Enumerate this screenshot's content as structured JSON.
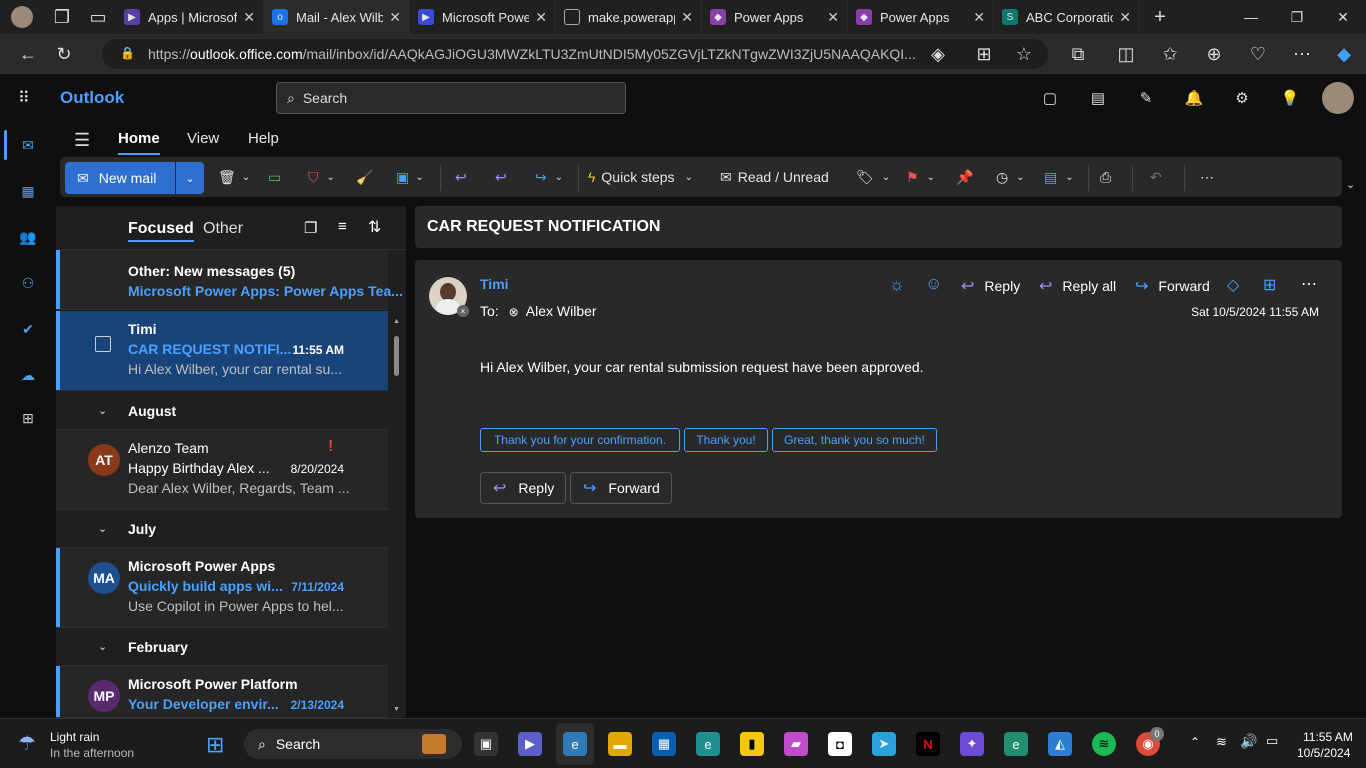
{
  "browser": {
    "tabs": [
      {
        "title": "Apps | Microsoft",
        "icon": "power-apps-icon",
        "color": "#7a4bd1"
      },
      {
        "title": "Mail - Alex Wilber",
        "icon": "outlook-icon",
        "color": "#1a73e8",
        "active": true
      },
      {
        "title": "Microsoft Power",
        "icon": "power-platform-icon",
        "color": "#3a4bd1"
      },
      {
        "title": "make.powerapps",
        "icon": "page-icon",
        "color": "#888888"
      },
      {
        "title": "Power Apps",
        "icon": "power-apps-icon",
        "color": "#8a3ea8"
      },
      {
        "title": "Power Apps",
        "icon": "power-apps-icon",
        "color": "#8a3ea8"
      },
      {
        "title": "ABC Corporation",
        "icon": "sharepoint-icon",
        "color": "#0b7a6e"
      }
    ],
    "url_prefix": "https://",
    "url_host": "outlook.office.com",
    "url_rest": "/mail/inbox/id/AAQkAGJiOGU3MWZkLTU3ZmUtNDI5My05ZGVjLTZkNTgwZWI3ZjU5NAAQAKQI..."
  },
  "app": {
    "brand": "Outlook",
    "search_placeholder": "Search"
  },
  "ribbon": {
    "tabs": [
      "Home",
      "View",
      "Help"
    ],
    "new_mail": "New mail",
    "quick_steps": "Quick steps",
    "read_unread": "Read / Unread"
  },
  "list": {
    "focused": "Focused",
    "other": "Other",
    "other_banner_title": "Other: New messages (5)",
    "other_banner_sub": "Microsoft Power Apps: Power Apps Tea...",
    "groups": {
      "august": "August",
      "july": "July",
      "february": "February"
    },
    "messages": [
      {
        "sender": "Timi",
        "subject": "CAR REQUEST NOTIFI...",
        "date": "11:55 AM",
        "preview": "Hi Alex Wilber, your car rental su..."
      },
      {
        "sender": "Alenzo Team",
        "initials": "AT",
        "subject": "Happy Birthday Alex ...",
        "date": "8/20/2024",
        "preview": "Dear Alex Wilber, Regards, Team ...",
        "avatar_color": "#8a3a1a"
      },
      {
        "sender": "Microsoft Power Apps",
        "initials": "MA",
        "subject": "Quickly build apps wi...",
        "date": "7/11/2024",
        "preview": "Use Copilot in Power Apps to hel...",
        "avatar_color": "#1e4f8f"
      },
      {
        "sender": "Microsoft Power Platform",
        "initials": "MP",
        "subject": "Your Developer envir...",
        "date": "2/13/2024",
        "avatar_color": "#5a2a6e"
      }
    ]
  },
  "reading": {
    "subject": "CAR REQUEST NOTIFICATION",
    "from": "Timi",
    "to_label": "To:",
    "to": "Alex Wilber",
    "date": "Sat 10/5/2024 11:55 AM",
    "body": "Hi Alex Wilber, your car rental submission request have been approved.",
    "actions": {
      "reply": "Reply",
      "reply_all": "Reply all",
      "forward": "Forward"
    },
    "suggestions": [
      "Thank you for your confirmation.",
      "Thank you!",
      "Great, thank you so much!"
    ],
    "bottom_reply": "Reply",
    "bottom_forward": "Forward"
  },
  "taskbar": {
    "weather_title": "Light rain",
    "weather_sub": "In the afternoon",
    "search": "Search",
    "time": "11:55 AM",
    "date": "10/5/2024",
    "chrome_badge": "0"
  }
}
